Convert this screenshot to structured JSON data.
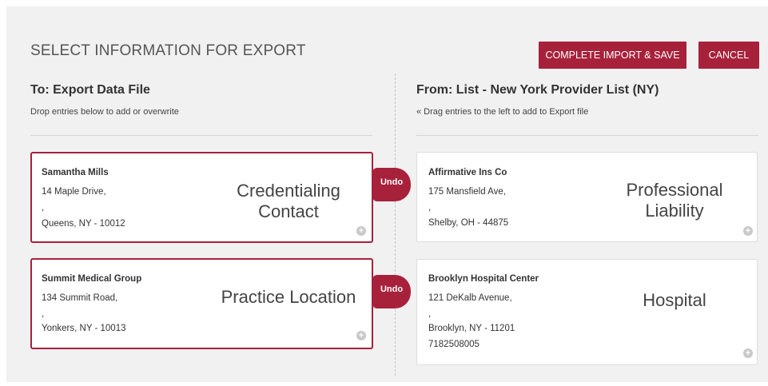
{
  "header": {
    "title": "SELECT INFORMATION FOR EXPORT",
    "complete_label": "COMPLETE IMPORT & SAVE",
    "cancel_label": "CANCEL"
  },
  "left_column": {
    "title": "To: Export Data File",
    "subtitle": "Drop entries below to add or overwrite"
  },
  "right_column": {
    "title": "From: List - New York Provider List (NY)",
    "subtitle": "« Drag entries to the left to add to Export file"
  },
  "export_cards": [
    {
      "name": "Samantha Mills",
      "address": "14 Maple Drive,",
      "address2": ",",
      "city": "Queens, NY - 10012",
      "type_line1": "Credentialing",
      "type_line2": "Contact",
      "undo_label": "Undo"
    },
    {
      "name": "Summit Medical Group",
      "address": "134 Summit Road,",
      "address2": ",",
      "city": "Yonkers, NY - 10013",
      "type_line1": "Practice Location",
      "undo_label": "Undo"
    }
  ],
  "source_cards": [
    {
      "name": "Affirmative Ins Co",
      "address": "175 Mansfield Ave,",
      "address2": ",",
      "city": "Shelby, OH - 44875",
      "type_line1": "Professional",
      "type_line2": "Liability"
    },
    {
      "name": "Brooklyn Hospital Center",
      "address": "121 DeKalb Avenue,",
      "address2": ",",
      "city": "Brooklyn, NY - 11201",
      "phone": "7182508005",
      "type_line1": "Hospital"
    }
  ],
  "icons": {
    "add": "plus-circle-icon"
  },
  "colors": {
    "accent": "#a8213a",
    "panel_bg": "#f1f1f1"
  }
}
